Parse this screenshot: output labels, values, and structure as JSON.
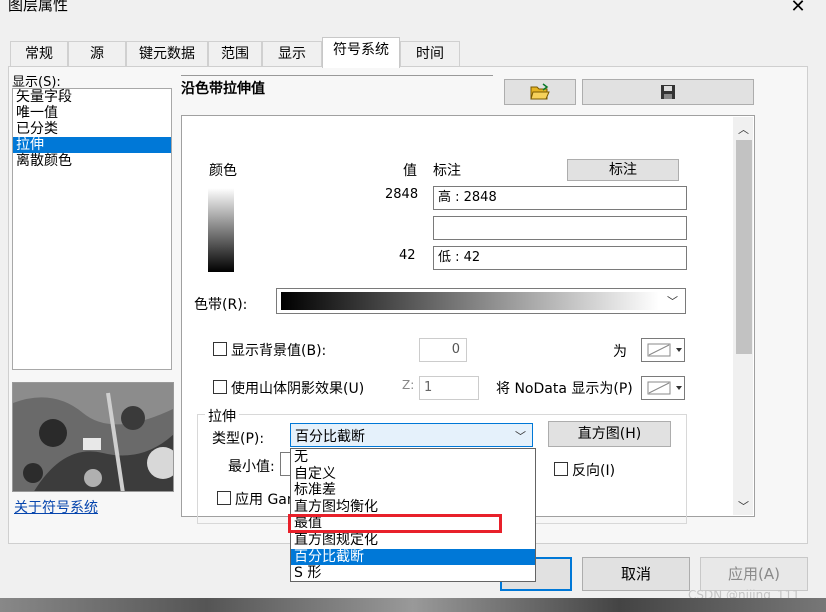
{
  "window": {
    "title": "图层属性",
    "close_glyph": "✕"
  },
  "tabs": [
    "常规",
    "源",
    "键元数据",
    "范围",
    "显示",
    "符号系统",
    "时间"
  ],
  "show_label": "显示(S):",
  "show_list": {
    "items": [
      "矢量字段",
      "唯一值",
      "已分类",
      "拉伸",
      "离散颜色"
    ],
    "selected": "拉伸"
  },
  "about_link": "关于符号系统",
  "heading": "沿色带拉伸值",
  "toolbar": {
    "open_icon": "folder-open-icon",
    "save_icon": "save-disk-icon"
  },
  "legend": {
    "color_label": "颜色",
    "value_label": "值",
    "label_label": "标注",
    "label_button": "标注",
    "high_value": "2848",
    "high_label": "高 : 2848",
    "middle_label": "",
    "low_value": "42",
    "low_label": "低 : 42"
  },
  "color_ramp_label": "色带(R):",
  "background": {
    "label": "显示背景值(B):",
    "value": "0",
    "as_label": "为"
  },
  "hillshade": {
    "label": "使用山体阴影效果(U)",
    "z_label": "Z:",
    "z_value": "1",
    "nodata_label": "将 NoData 显示为(P)"
  },
  "stretch": {
    "group_label": "拉伸",
    "type_label": "类型(P):",
    "type_value": "百分比截断",
    "histogram_button": "直方图(H)",
    "min_label": "最小值:",
    "invert_label": "反向(I)",
    "gamma_label": "应用 Gam",
    "options": [
      "无",
      "自定义",
      "标准差",
      "直方图均衡化",
      "最值",
      "直方图规定化",
      "百分比截断",
      "S 形"
    ],
    "selected_option": "百分比截断",
    "highlighted_option": "最值"
  },
  "buttons": {
    "cancel": "取消",
    "apply": "应用(A)"
  },
  "watermark": "CSDN @nijing_111",
  "colors": {
    "accent": "#0078d7",
    "highlight_box": "#e8202a"
  }
}
